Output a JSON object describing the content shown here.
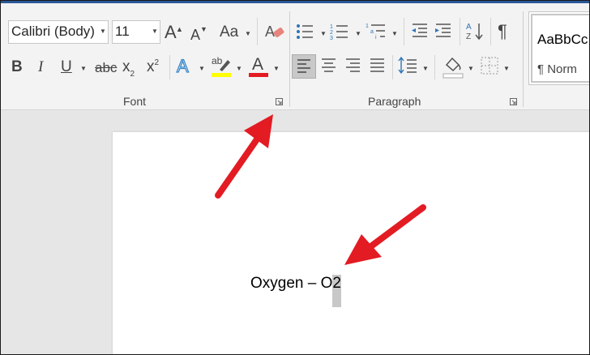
{
  "font": {
    "name": "Calibri (Body)",
    "size": "11",
    "grow_glyph": "A",
    "shrink_glyph": "A",
    "case_glyph": "Aa",
    "group_label": "Font"
  },
  "format": {
    "bold": "B",
    "italic": "I",
    "underline": "U",
    "strikethrough": "abc",
    "subscript": "x",
    "subscript_mark": "2",
    "superscript": "x",
    "superscript_mark": "2",
    "text_effects": "A",
    "highlight_letters": "ab",
    "font_color": "A"
  },
  "paragraph": {
    "group_label": "Paragraph",
    "pilcrow": "¶"
  },
  "styles": {
    "preview": "AaBbCc",
    "name": "¶ Norm"
  },
  "colors": {
    "highlight": "#ffff00",
    "font_color": "#e31b23",
    "arrow": "#e31b23",
    "selection": "#c8c8c8",
    "accent": "#2b579a"
  },
  "document": {
    "line_text": "Oxygen – O",
    "selected_text": "2"
  }
}
